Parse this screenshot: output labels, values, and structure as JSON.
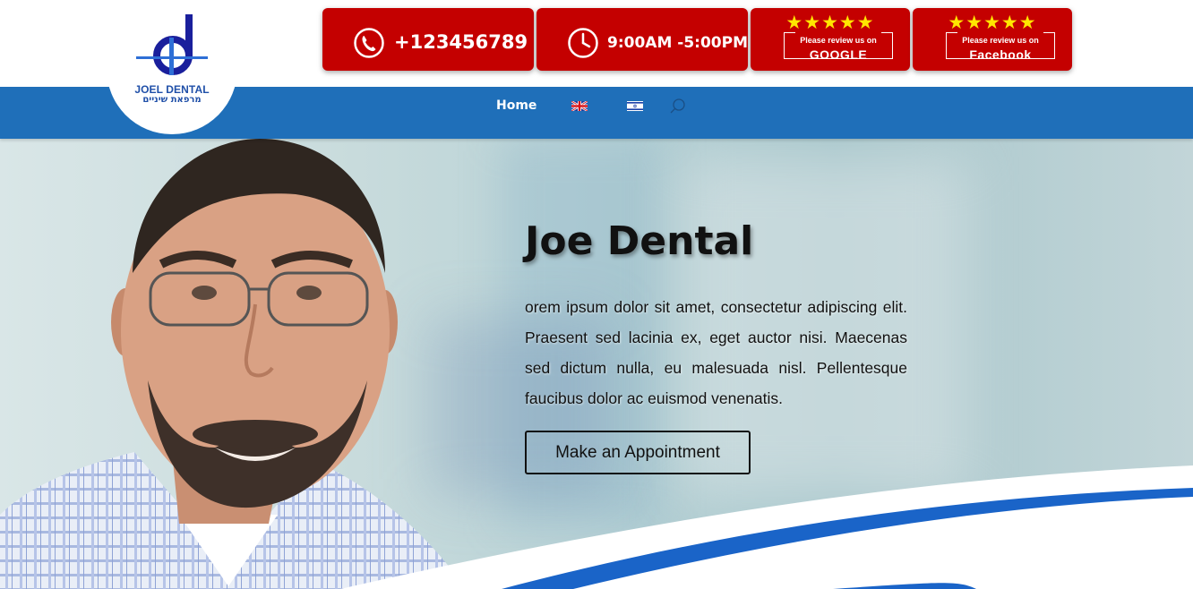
{
  "header": {
    "logo": {
      "name": "JOEL DENTAL",
      "subtitle": "מרפאת שיניים"
    },
    "phone_tile": {
      "icon": "phone-icon",
      "text": "+123456789"
    },
    "hours_tile": {
      "icon": "clock-icon",
      "text": "9:00AM -5:00PM"
    },
    "google_tile": {
      "stars": "★★★★★",
      "line1": "Please review us on",
      "line2": "GOOGLE"
    },
    "facebook_tile": {
      "stars": "★★★★★",
      "line1": "Please review us on",
      "line2": "Facebook"
    }
  },
  "nav": {
    "home": "Home",
    "flags": [
      "uk-flag-icon",
      "israel-flag-icon"
    ],
    "search_icon": "search-icon"
  },
  "hero": {
    "title": "Joe Dental",
    "text": "orem ipsum dolor sit amet, consectetur adipiscing elit. Praesent sed lacinia ex, eget auctor nisi. Maecenas sed dictum nulla, eu malesuada nisl. Pellentesque faucibus dolor ac euismod venenatis.",
    "button": "Make an Appointment"
  },
  "colors": {
    "tile_red": "#c40000",
    "nav_blue": "#1f6fb9",
    "logo_blue": "#1f4fa8",
    "star_yellow": "#ffe600"
  }
}
